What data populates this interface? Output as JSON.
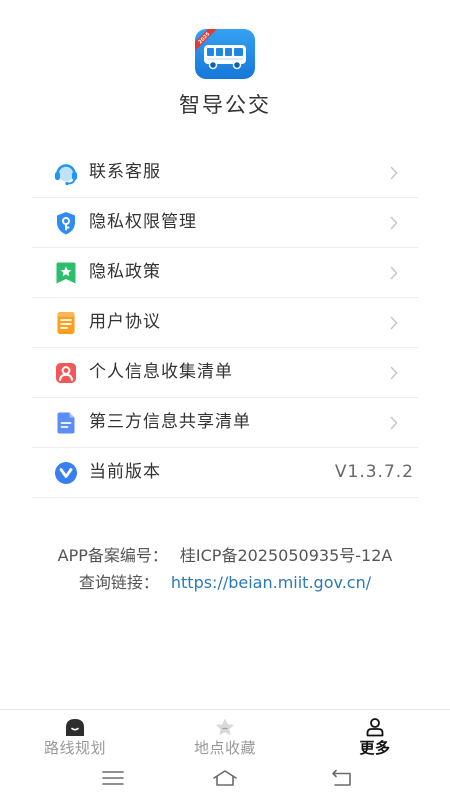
{
  "app": {
    "name": "智导公交",
    "icon": "bus-logo-icon",
    "icon_badge": "2025",
    "brand_color": "#1f86e3",
    "badge_color": "#e53935"
  },
  "menu": {
    "items": [
      {
        "label": "联系客服",
        "icon": "headset-icon",
        "icon_color": "#2196f3"
      },
      {
        "label": "隐私权限管理",
        "icon": "shield-key-icon",
        "icon_color": "#2f8cf4"
      },
      {
        "label": "隐私政策",
        "icon": "bookmark-star-icon",
        "icon_color": "#2dbe6c"
      },
      {
        "label": "用户协议",
        "icon": "document-icon",
        "icon_color": "#ff9d1c"
      },
      {
        "label": "个人信息收集清单",
        "icon": "person-icon",
        "icon_color": "#f2585a"
      },
      {
        "label": "第三方信息共享清单",
        "icon": "document-lines-icon",
        "icon_color": "#5a8ef6"
      },
      {
        "label": "当前版本",
        "icon": "version-icon",
        "icon_color": "#3a7ff0",
        "value": "V1.3.7.2"
      }
    ]
  },
  "footer": {
    "icp_label": "APP备案编号：",
    "icp_value": "桂ICP备2025050935号-12A",
    "link_label": "查询链接：",
    "link_value": "https://beian.miit.gov.cn/"
  },
  "tabbar": {
    "tabs": [
      {
        "label": "路线规划",
        "icon": "route-icon",
        "active": false
      },
      {
        "label": "地点收藏",
        "icon": "favorite-icon",
        "active": false
      },
      {
        "label": "更多",
        "icon": "user-icon",
        "active": true
      }
    ]
  },
  "system_nav": {
    "buttons": [
      {
        "icon": "menu-icon"
      },
      {
        "icon": "home-icon"
      },
      {
        "icon": "back-icon"
      }
    ]
  },
  "colors": {
    "text_primary": "#333333",
    "text_secondary": "#666666",
    "text_muted": "#999999",
    "divider": "#ededed",
    "link": "#2a7ab8",
    "tab_active": "#111111",
    "chevron": "#c4c4c4"
  }
}
